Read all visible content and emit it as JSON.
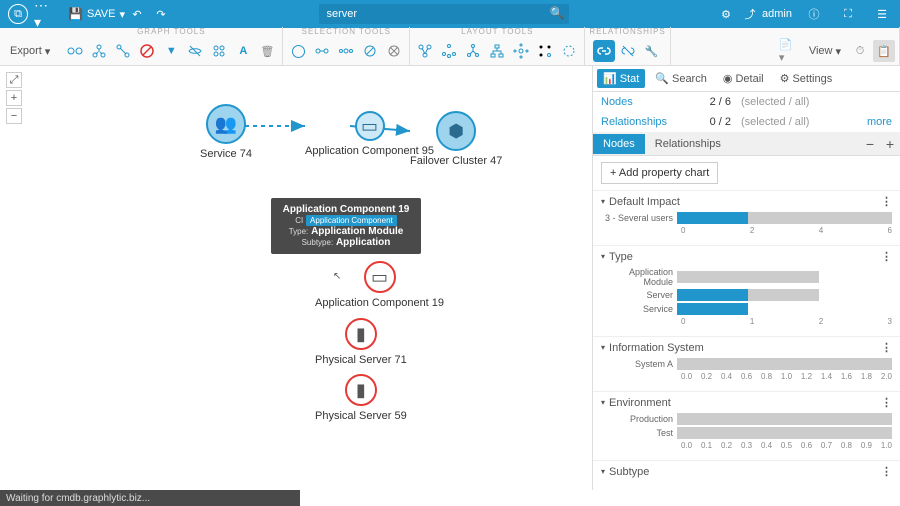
{
  "header": {
    "save_label": "SAVE",
    "search_value": "server",
    "user": "admin"
  },
  "toolbar": {
    "export_label": "Export",
    "view_label": "View",
    "groups": {
      "graph": "GRAPH TOOLS",
      "selection": "SELECTION TOOLS",
      "layout": "LAYOUT TOOLS",
      "relationships": "RELATIONSHIPS"
    }
  },
  "canvas": {
    "nodes": {
      "service74": "Service 74",
      "appcomp95": "Application Component 95",
      "failover47": "Failover Cluster 47",
      "appcomp19": "Application Component 19",
      "physsrv71": "Physical Server 71",
      "physsrv59": "Physical Server 59"
    },
    "tooltip": {
      "title": "Application Component 19",
      "badge_pre": "CI",
      "badge": "Application Component",
      "type_label": "Type:",
      "type_value": "Application Module",
      "subtype_label": "Subtype:",
      "subtype_value": "Application"
    }
  },
  "panel": {
    "tabs1": {
      "stat": "Stat",
      "search": "Search",
      "detail": "Detail",
      "settings": "Settings"
    },
    "stats": {
      "nodes_k": "Nodes",
      "nodes_v": "2 / 6",
      "nodes_d": "(selected / all)",
      "rels_k": "Relationships",
      "rels_v": "0 / 2",
      "rels_d": "(selected / all)",
      "more": "more"
    },
    "tabs2": {
      "nodes": "Nodes",
      "rels": "Relationships"
    },
    "addbtn": "+  Add property chart",
    "sections": {
      "impact": {
        "title": "Default Impact",
        "row": "3 - Several users"
      },
      "type": {
        "title": "Type",
        "r1": "Application Module",
        "r2": "Server",
        "r3": "Service"
      },
      "infosys": {
        "title": "Information System",
        "r1": "System A"
      },
      "env": {
        "title": "Environment",
        "r1": "Production",
        "r2": "Test"
      },
      "subtype": {
        "title": "Subtype"
      }
    }
  },
  "chart_data": [
    {
      "type": "bar",
      "title": "Default Impact",
      "categories": [
        "3 - Several users"
      ],
      "series": [
        {
          "name": "selected",
          "values": [
            2
          ]
        },
        {
          "name": "all",
          "values": [
            6
          ]
        }
      ],
      "xlim": [
        0,
        6
      ]
    },
    {
      "type": "bar",
      "title": "Type",
      "categories": [
        "Application Module",
        "Server",
        "Service"
      ],
      "series": [
        {
          "name": "selected",
          "values": [
            0,
            1,
            1
          ]
        },
        {
          "name": "all",
          "values": [
            2,
            2,
            1
          ]
        }
      ],
      "xlim": [
        0,
        3
      ]
    },
    {
      "type": "bar",
      "title": "Information System",
      "categories": [
        "System A"
      ],
      "values": [
        2.0
      ],
      "xlim": [
        0,
        2
      ]
    },
    {
      "type": "bar",
      "title": "Environment",
      "categories": [
        "Production",
        "Test"
      ],
      "values": [
        1.0,
        1.0
      ],
      "xlim": [
        0,
        1
      ]
    }
  ],
  "status": "Waiting for cmdb.graphlytic.biz..."
}
